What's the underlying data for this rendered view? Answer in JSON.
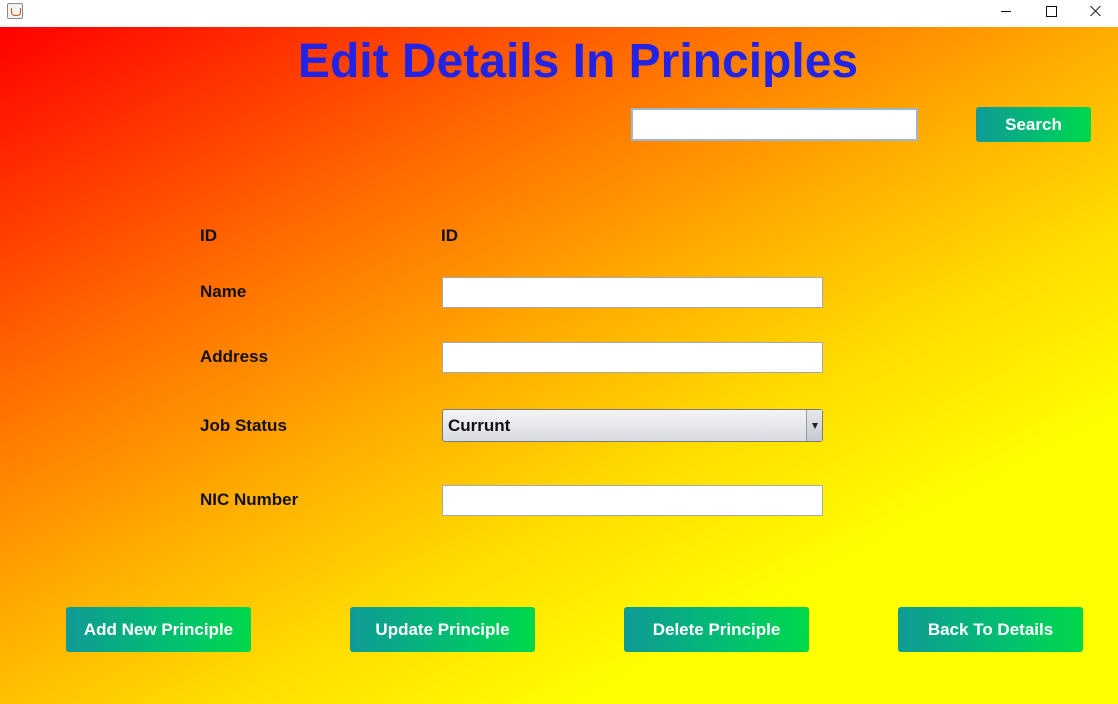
{
  "window": {
    "title": "",
    "controls": {
      "minimize_icon": "minimize-icon",
      "maximize_icon": "maximize-icon",
      "close_icon": "close-icon"
    }
  },
  "page": {
    "title": "Edit Details In Principles",
    "title_color": "#2323e6"
  },
  "search": {
    "value": "",
    "placeholder": "",
    "button_label": "Search"
  },
  "form": {
    "id_label": "ID",
    "id_value": "ID",
    "name_label": "Name",
    "name_value": "",
    "address_label": "Address",
    "address_value": "",
    "job_status_label": "Job Status",
    "job_status_value": "Currunt",
    "nic_label": "NIC Number",
    "nic_value": ""
  },
  "actions": {
    "add_label": "Add New Principle",
    "update_label": "Update Principle",
    "delete_label": "Delete Principle",
    "back_label": "Back To Details"
  },
  "colors": {
    "button_gradient_start": "#0f9a96",
    "button_gradient_end": "#00d84a",
    "background_start": "#ff0000",
    "background_end": "#ffff00"
  }
}
